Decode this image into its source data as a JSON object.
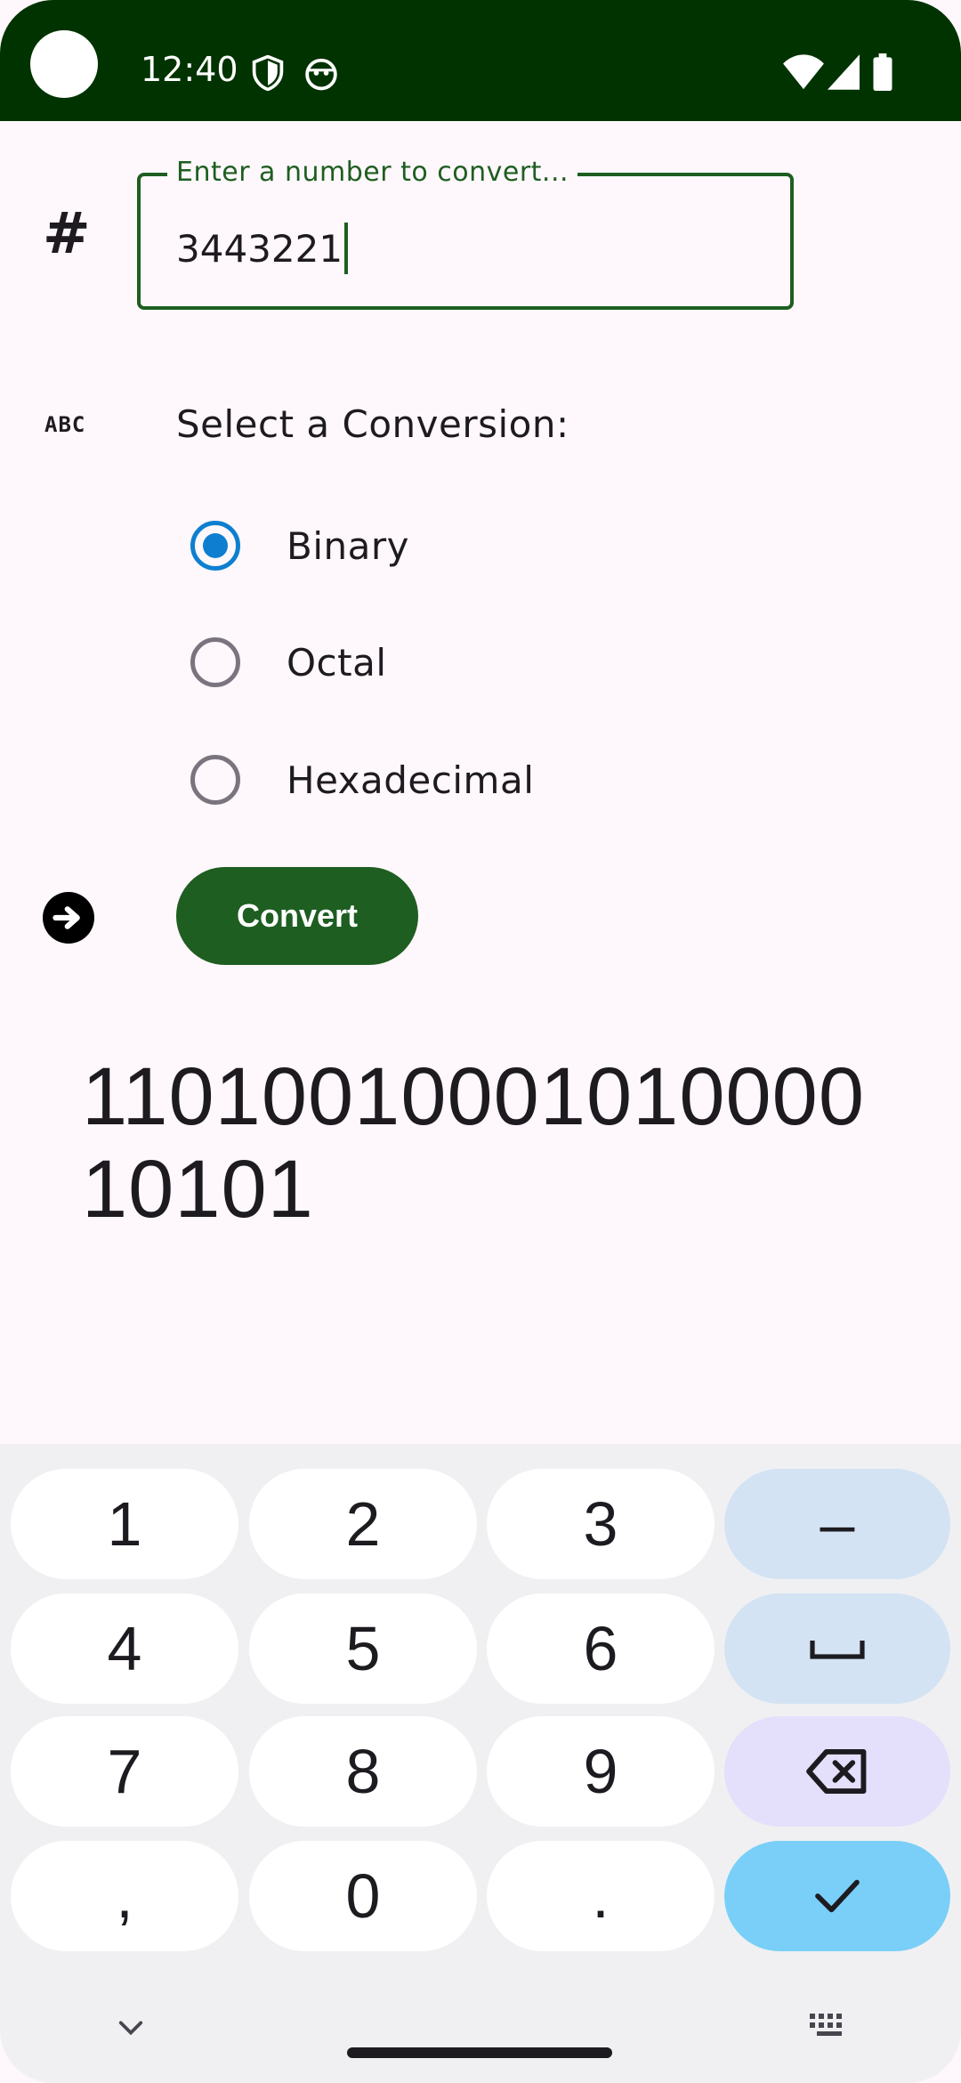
{
  "status_bar": {
    "time": "12:40",
    "icons": [
      "shield-icon",
      "android-icon",
      "wifi-icon",
      "signal-icon",
      "battery-icon"
    ]
  },
  "number_input": {
    "label": "Enter a number to convert...",
    "value": "3443221",
    "icon": "hash-icon",
    "icon_text": "#"
  },
  "conversion": {
    "icon": "abc-icon",
    "icon_text": "ABC",
    "label": "Select a Conversion:",
    "options": [
      {
        "label": "Binary",
        "selected": true
      },
      {
        "label": "Octal",
        "selected": false
      },
      {
        "label": "Hexadecimal",
        "selected": false
      }
    ]
  },
  "convert": {
    "icon": "arrow-right-circle-icon",
    "label": "Convert"
  },
  "result": {
    "value": "1101001000101000010101"
  },
  "keyboard": {
    "keys": [
      [
        "1",
        "2",
        "3",
        "–"
      ],
      [
        "4",
        "5",
        "6",
        "space"
      ],
      [
        "7",
        "8",
        "9",
        "backspace"
      ],
      [
        ",",
        "0",
        ".",
        "done"
      ]
    ],
    "bottom_icons": [
      "chevron-down-icon",
      "keyboard-icon"
    ]
  },
  "colors": {
    "status_bar": "#013301",
    "primary": "#1e5e21",
    "radio_selected": "#0e7fd0",
    "background": "#fef7fb",
    "key_fn": "#d3e3f3",
    "key_delete": "#e4dffb",
    "key_done": "#79cff7"
  }
}
